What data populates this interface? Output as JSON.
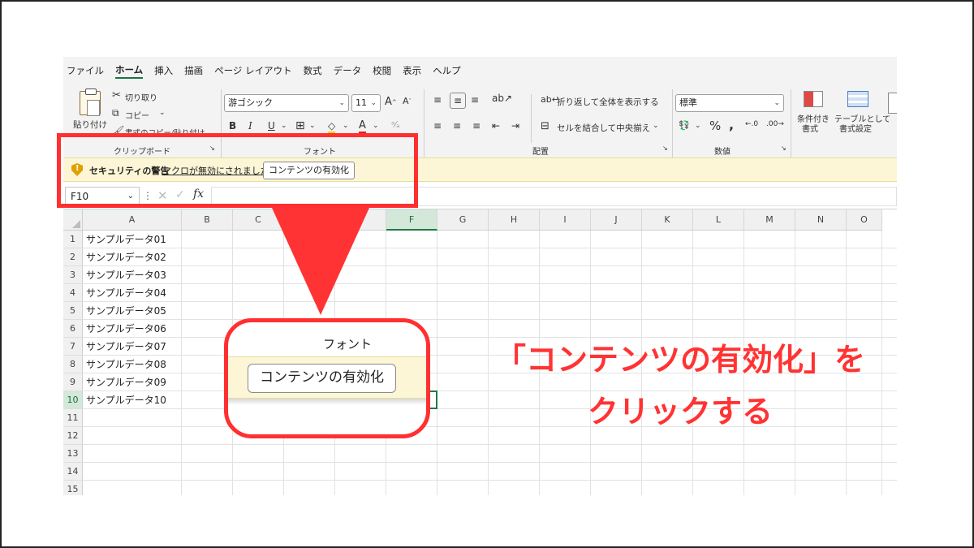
{
  "menu": [
    "ファイル",
    "ホーム",
    "挿入",
    "描画",
    "ページ レイアウト",
    "数式",
    "データ",
    "校閲",
    "表示",
    "ヘルプ"
  ],
  "menu_active_index": 1,
  "ribbon": {
    "paste_label": "貼り付け",
    "cut_label": "切り取り",
    "copy_label": "コピー",
    "format_painter_label": "書式のコピー/貼り付け",
    "clipboard_group": "クリップボード",
    "font_name": "游ゴシック",
    "font_size": "11",
    "font_group": "フォント",
    "bold": "B",
    "italic": "I",
    "underline": "U",
    "wrap_text_label": "折り返して全体を表示する",
    "merge_center_label": "セルを結合して中央揃え",
    "alignment_group": "配置",
    "number_format": "標準",
    "number_group": "数値",
    "percent": "%",
    "comma": ",",
    "conditional_format_line1": "条件付き",
    "conditional_format_line2": "書式",
    "format_table_line1": "テーブルとして",
    "format_table_line2": "書式設定"
  },
  "security": {
    "title": "セキュリティの警告",
    "message": "マクロが無効にされました。",
    "button": "コンテンツの有効化"
  },
  "formula_bar": {
    "name_box": "F10",
    "fx": "fx"
  },
  "columns": [
    "A",
    "B",
    "C",
    "D",
    "E",
    "F",
    "G",
    "H",
    "I",
    "J",
    "K",
    "L",
    "M",
    "N",
    "O"
  ],
  "rows": [
    "1",
    "2",
    "3",
    "4",
    "5",
    "6",
    "7",
    "8",
    "9",
    "10",
    "11",
    "12",
    "13",
    "14",
    "15"
  ],
  "cells_A": [
    "サンプルデータ01",
    "サンプルデータ02",
    "サンプルデータ03",
    "サンプルデータ04",
    "サンプルデータ05",
    "サンプルデータ06",
    "サンプルデータ07",
    "サンプルデータ08",
    "サンプルデータ09",
    "サンプルデータ10"
  ],
  "selected_cell": "F10",
  "zoom": {
    "label": "フォント",
    "button": "コンテンツの有効化"
  },
  "callout": {
    "line1": "「コンテンツの有効化」を",
    "line2": "クリックする"
  },
  "colors": {
    "annotation_red": "#ff3333",
    "excel_green": "#1e7b45",
    "warning_bar": "#fcf6d6",
    "shield": "#e0a100"
  }
}
